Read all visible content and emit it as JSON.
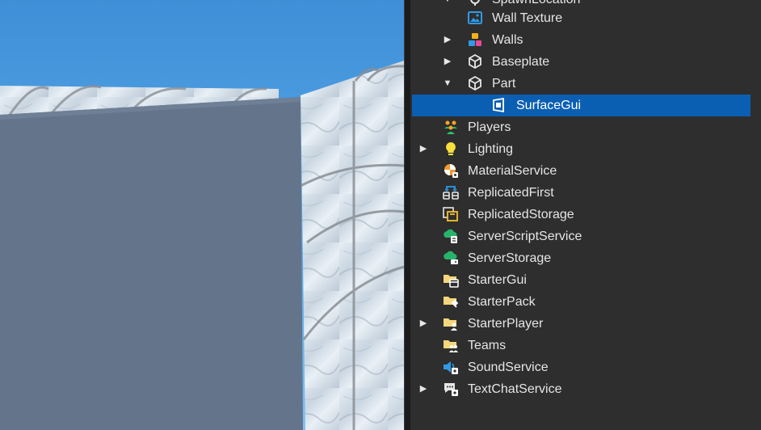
{
  "viewport": {
    "sky_color": "#4fa3e4",
    "wall_color": "#d8e2ea",
    "part_color": "#64748a"
  },
  "explorer": {
    "selection_color": "#0b5fb3",
    "items": [
      {
        "label": "SpawnLocation",
        "icon": "spawn-location-icon",
        "arrow": "expanded"
      },
      {
        "label": "Wall Texture",
        "icon": "texture-icon",
        "arrow": "none"
      },
      {
        "label": "Walls",
        "icon": "model-icon",
        "arrow": "collapsed"
      },
      {
        "label": "Baseplate",
        "icon": "part-icon",
        "arrow": "collapsed"
      },
      {
        "label": "Part",
        "icon": "part-icon",
        "arrow": "expanded"
      },
      {
        "label": "SurfaceGui",
        "icon": "surface-gui-icon",
        "arrow": "none",
        "selected": true
      },
      {
        "label": "Players",
        "icon": "players-icon",
        "arrow": "none"
      },
      {
        "label": "Lighting",
        "icon": "lighting-icon",
        "arrow": "collapsed"
      },
      {
        "label": "MaterialService",
        "icon": "material-service-icon",
        "arrow": "none"
      },
      {
        "label": "ReplicatedFirst",
        "icon": "replicated-first-icon",
        "arrow": "none"
      },
      {
        "label": "ReplicatedStorage",
        "icon": "replicated-storage-icon",
        "arrow": "none"
      },
      {
        "label": "ServerScriptService",
        "icon": "server-script-service-icon",
        "arrow": "none"
      },
      {
        "label": "ServerStorage",
        "icon": "server-storage-icon",
        "arrow": "none"
      },
      {
        "label": "StarterGui",
        "icon": "starter-gui-icon",
        "arrow": "none"
      },
      {
        "label": "StarterPack",
        "icon": "starter-pack-icon",
        "arrow": "none"
      },
      {
        "label": "StarterPlayer",
        "icon": "starter-player-icon",
        "arrow": "collapsed"
      },
      {
        "label": "Teams",
        "icon": "teams-icon",
        "arrow": "none"
      },
      {
        "label": "SoundService",
        "icon": "sound-service-icon",
        "arrow": "none"
      },
      {
        "label": "TextChatService",
        "icon": "text-chat-service-icon",
        "arrow": "collapsed"
      }
    ]
  }
}
